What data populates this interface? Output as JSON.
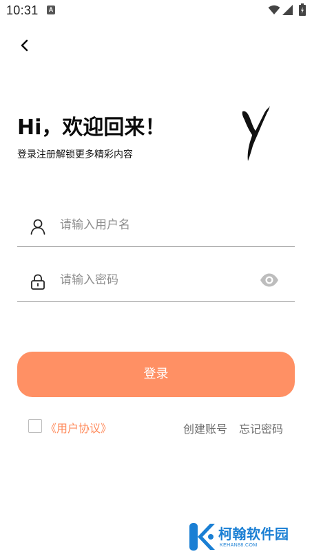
{
  "status_bar": {
    "time": "10:31",
    "notification_icon": "a-icon",
    "icons": [
      "wifi-icon",
      "signal-icon",
      "battery-icon"
    ]
  },
  "nav": {
    "back_icon": "chevron-left-icon"
  },
  "header": {
    "title": "Hi，欢迎回来！",
    "subtitle": "登录注册解锁更多精彩内容",
    "logo": "brush-y-logo"
  },
  "form": {
    "username": {
      "icon": "user-icon",
      "placeholder": "请输入用户名",
      "value": ""
    },
    "password": {
      "icon": "lock-icon",
      "placeholder": "请输入密码",
      "value": "",
      "toggle_icon": "eye-icon"
    },
    "login_label": "登录"
  },
  "footer": {
    "agreement_checked": false,
    "agreement_link": "《用户协议》",
    "register_link": "创建账号",
    "forgot_link": "忘记密码"
  },
  "watermark": {
    "name": "柯翰软件园",
    "url": "KEHAN88.COM"
  },
  "colors": {
    "accent": "#ff9064",
    "link": "#ff8a5b",
    "watermark": "#1a7fd4"
  }
}
